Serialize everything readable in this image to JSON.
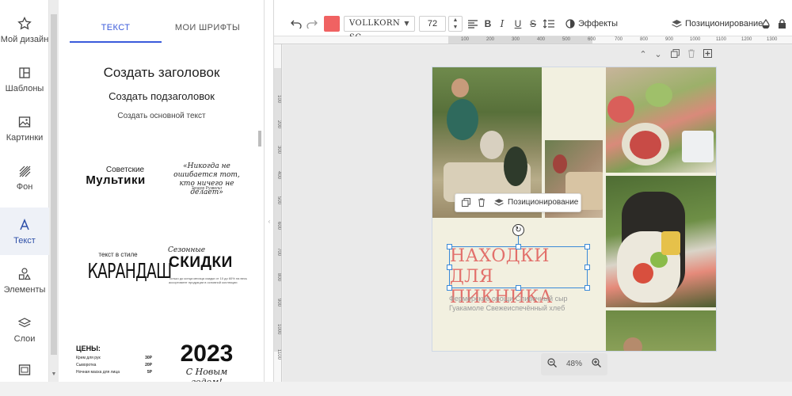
{
  "nav": {
    "items": [
      {
        "label": "Мой дизайн",
        "icon": "star-icon"
      },
      {
        "label": "Шаблоны",
        "icon": "template-icon"
      },
      {
        "label": "Картинки",
        "icon": "image-icon"
      },
      {
        "label": "Фон",
        "icon": "background-pattern-icon"
      },
      {
        "label": "Текст",
        "icon": "text-icon",
        "active": true
      },
      {
        "label": "Элементы",
        "icon": "shapes-icon"
      },
      {
        "label": "Слои",
        "icon": "layers-icon"
      }
    ]
  },
  "panel": {
    "tabs": [
      "ТЕКСТ",
      "МОИ ШРИФТЫ"
    ],
    "add_heading": "Создать заголовок",
    "add_subheading": "Создать подзаголовок",
    "add_body": "Создать основной текст",
    "templates": {
      "mult_a": "Советские",
      "mult_b": "Мультики",
      "quote": "«Никогда не ошибается тот, кто ничего не делает»",
      "quote_by": "Теодор Рузвельт",
      "kar_a": "текст в стиле",
      "kar_b": "КАРАНДАШ",
      "sk_a": "Сезонные",
      "sk_b": "СКИДКИ",
      "sk_c": "Только до конца месяца скидки от 10 до 60% на весь ассортимент продукции в основной коллекции",
      "price_title": "ЦЕНЫ:",
      "price_rows": [
        {
          "name": "Крем для рук",
          "price": "30Р"
        },
        {
          "name": "Сыворотка",
          "price": "20Р"
        },
        {
          "name": "Ночная маска для лица",
          "price": "5Р"
        }
      ],
      "year": "2023",
      "year_sub": "С Новым годом!"
    }
  },
  "toolbar": {
    "undo_icon": "undo-icon",
    "redo_icon": "redo-icon",
    "text_color": "#f06262",
    "font_name": "VOLLKORN SC",
    "font_size": "72",
    "effects_label": "Эффекты",
    "positioning_label": "Позиционирование"
  },
  "ruler": {
    "top_ticks": [
      "100",
      "200",
      "300",
      "400",
      "500",
      "600",
      "700",
      "800",
      "900",
      "1000",
      "1100",
      "1200",
      "1300"
    ],
    "left_ticks": [
      "100",
      "200",
      "300",
      "400",
      "500",
      "600",
      "700",
      "800",
      "900",
      "1000",
      "1100"
    ]
  },
  "canvas": {
    "floating_bar": {
      "positioning_label": "Позиционирование"
    },
    "title": "НАХОДКИ ДЛЯ ПИКНИКА",
    "subtitle": "Фермерские овощи Сливочный сыр Гуакамоле Свежеиспечённый хлеб",
    "title_color": "#e2706b"
  },
  "zoom": {
    "value": "48%"
  }
}
